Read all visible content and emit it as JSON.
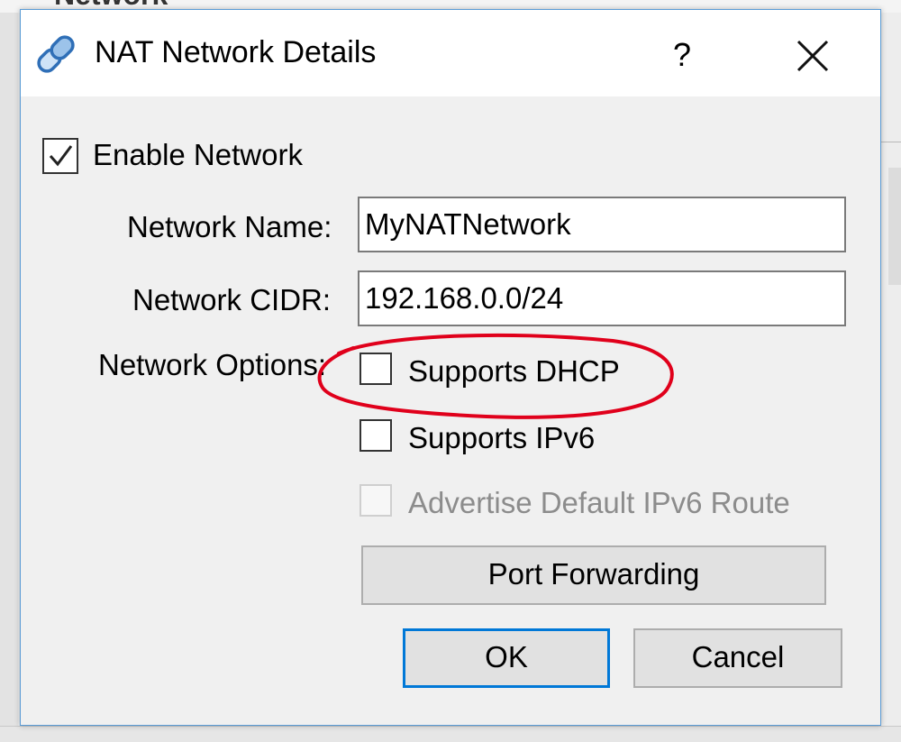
{
  "background": {
    "top_text": "Network"
  },
  "dialog": {
    "title": "NAT Network Details",
    "title_icon": "link-icon",
    "help_label": "?",
    "close_icon": "close-icon",
    "enable_network": {
      "label": "Enable Network",
      "checked": true
    },
    "network_name": {
      "label": "Network Name:",
      "value": "MyNATNetwork"
    },
    "network_cidr": {
      "label": "Network CIDR:",
      "value": "192.168.0.0/24"
    },
    "network_options": {
      "label": "Network Options:",
      "supports_dhcp": {
        "label": "Supports DHCP",
        "checked": false
      },
      "supports_ipv6": {
        "label": "Supports IPv6",
        "checked": false
      },
      "advertise_default_ipv6_route": {
        "label": "Advertise Default IPv6 Route",
        "checked": false,
        "enabled": false
      }
    },
    "port_forwarding_label": "Port Forwarding",
    "ok_label": "OK",
    "cancel_label": "Cancel"
  },
  "colors": {
    "dialog_border": "#5a9bd5",
    "default_button_border": "#0078d7",
    "annotation_circle": "#e0001b"
  }
}
